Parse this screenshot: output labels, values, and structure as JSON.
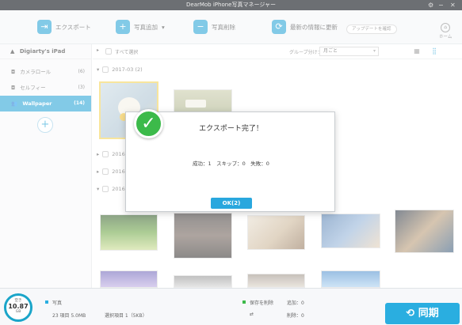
{
  "app": {
    "title": "DearMob iPhone写真マネージャー"
  },
  "toolbar": {
    "export_label": "エクスポート",
    "add_label": "写真追加",
    "delete_label": "写真削除",
    "refresh_label": "最新の情報に更新",
    "check_update_label": "アップデートを確認",
    "home_label": "ホーム"
  },
  "sidebar": {
    "device_name": "Digiarty's iPad",
    "items": [
      {
        "label": "カメラロール",
        "count": "(6)",
        "icon": "camera-icon"
      },
      {
        "label": "セルフィー",
        "count": "(3)",
        "icon": "camera-icon"
      },
      {
        "label": "Wallpaper",
        "count": "(14)",
        "icon": "people-icon",
        "active": true
      }
    ]
  },
  "filter": {
    "select_all": "すべて選択",
    "group_label": "グループ分け：",
    "group_value": "月ごと"
  },
  "groups": [
    {
      "label": "2017-03 (2)"
    },
    {
      "label": "2016"
    },
    {
      "label": "2016"
    },
    {
      "label": "2016"
    }
  ],
  "dialog": {
    "title": "エクスポート完了！",
    "result": "成功：1　スキップ：0　失敗：0",
    "ok_label": "OK(2)"
  },
  "status": {
    "storage_label": "空き",
    "storage_value": "10.87",
    "storage_unit": "GB",
    "photo_label": "写真",
    "photo_summary": "23 項目 5.0MB",
    "selected_summary": "選択項目 1（5KB）",
    "pending_label": "保存を削除",
    "added_label": "追加：0",
    "removed_label": "削除：0",
    "sync_label": "同期"
  },
  "colors": {
    "accent": "#1d9fd3",
    "success": "#3cba4a",
    "sync": "#2aaee0"
  }
}
